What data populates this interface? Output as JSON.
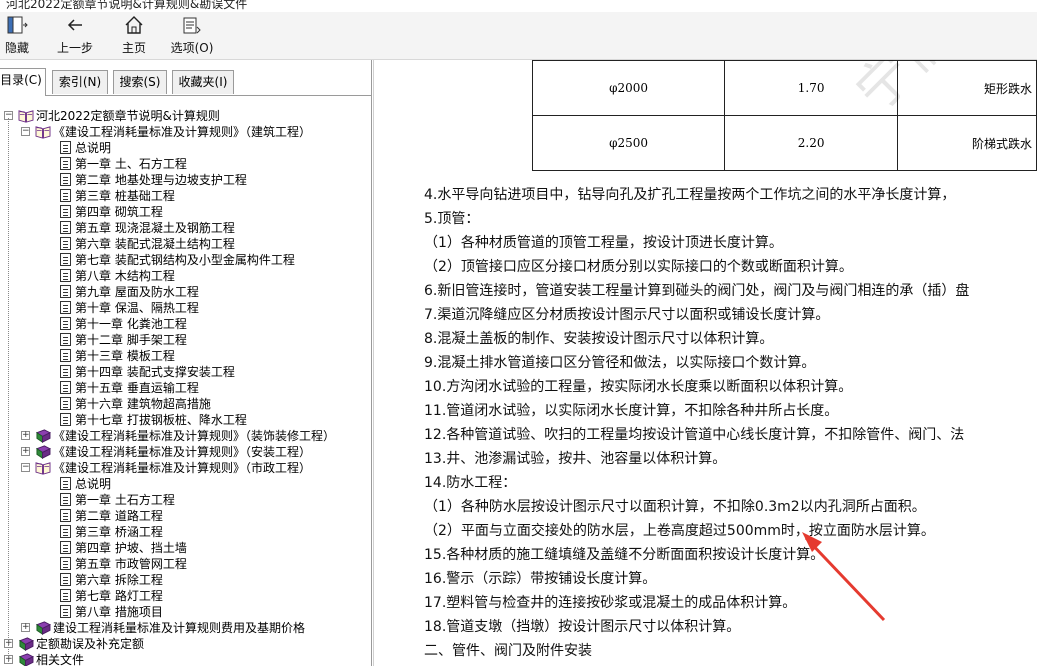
{
  "window": {
    "title": "河北2022定额章节说明&计算规则&勘误文件"
  },
  "toolbar": {
    "hide_label": "隐藏",
    "back_label": "上一步",
    "home_label": "主页",
    "options_label": "选项(O)"
  },
  "left_tabs": [
    "目录(C)",
    "索引(N)",
    "搜索(S)",
    "收藏夹(I)"
  ],
  "tree": {
    "root": "河北2022定额章节说明&计算规则",
    "building": "《建设工程消耗量标准及计算规则》（建筑工程）",
    "building_items": [
      "总说明",
      "第一章 土、石方工程",
      "第二章 地基处理与边坡支护工程",
      "第三章 桩基础工程",
      "第四章 砌筑工程",
      "第五章 现浇混凝土及钢筋工程",
      "第六章 装配式混凝土结构工程",
      "第七章 装配式钢结构及小型金属构件工程",
      "第八章 木结构工程",
      "第九章 屋面及防水工程",
      "第十章 保温、隔热工程",
      "第十一章 化粪池工程",
      "第十二章 脚手架工程",
      "第十三章 模板工程",
      "第十四章 装配式支撑安装工程",
      "第十五章 垂直运输工程",
      "第十六章 建筑物超高措施",
      "第十七章 打拔钢板桩、降水工程"
    ],
    "decoration": "《建设工程消耗量标准及计算规则》（装饰装修工程）",
    "installation": "《建设工程消耗量标准及计算规则》（安装工程）",
    "municipal": "《建设工程消耗量标准及计算规则》（市政工程）",
    "municipal_items": [
      "总说明",
      "第一章 土石方工程",
      "第二章 道路工程",
      "第三章 桥涵工程",
      "第四章 护坡、挡土墙",
      "第五章 市政管网工程",
      "第六章 拆除工程",
      "第七章 路灯工程",
      "第八章 措施项目"
    ],
    "fees": "建设工程消耗量标准及计算规则费用及基期价格",
    "errata": "定额勘误及补充定额",
    "related": "相关文件"
  },
  "table": {
    "rows": [
      {
        "dia": "φ2000",
        "val": "1.70",
        "type": "矩形跌水"
      },
      {
        "dia": "φ2500",
        "val": "2.20",
        "type": "阶梯式跌水"
      }
    ]
  },
  "content": {
    "lines": [
      "4.水平导向钻进项目中，钻导向孔及扩孔工程量按两个工作坑之间的水平净长度计算，",
      "5.顶管：",
      "（1）各种材质管道的顶管工程量，按设计顶进长度计算。",
      "（2）顶管接口应区分接口材质分别以实际接口的个数或断面积计算。",
      "6.新旧管连接时，管道安装工程量计算到碰头的阀门处，阀门及与阀门相连的承（插）盘",
      "7.渠道沉降缝应区分材质按设计图示尺寸以面积或铺设长度计算。",
      "8.混凝土盖板的制作、安装按设计图示尺寸以体积计算。",
      "9.混凝土排水管道接口区分管径和做法，以实际接口个数计算。",
      "10.方沟闭水试验的工程量，按实际闭水长度乘以断面积以体积计算。",
      "11.管道闭水试验，以实际闭水长度计算，不扣除各种井所占长度。",
      "12.各种管道试验、吹扫的工程量均按设计管道中心线长度计算，不扣除管件、阀门、法",
      "13.井、池渗漏试验，按井、池容量以体积计算。",
      "14.防水工程：",
      "（1）各种防水层按设计图示尺寸以面积计算，不扣除0.3m2以内孔洞所占面积。",
      "（2）平面与立面交接处的防水层，上卷高度超过500mm时，按立面防水层计算。",
      "15.各种材质的施工缝填缝及盖缝不分断面面积按设计长度计算。",
      "16.警示（示踪）带按铺设长度计算。",
      "17.塑料管与检查井的连接按砂浆或混凝土的成品体积计算。",
      "18.管道支墩（挡墩）按设计图示尺寸以体积计算。",
      "二、管件、阀门及附件安装"
    ],
    "watermark": "宁信息"
  },
  "colors": {
    "arrow": "#e53a2f",
    "book_purple": "#6a2c86",
    "book_green": "#2f8a3a"
  }
}
